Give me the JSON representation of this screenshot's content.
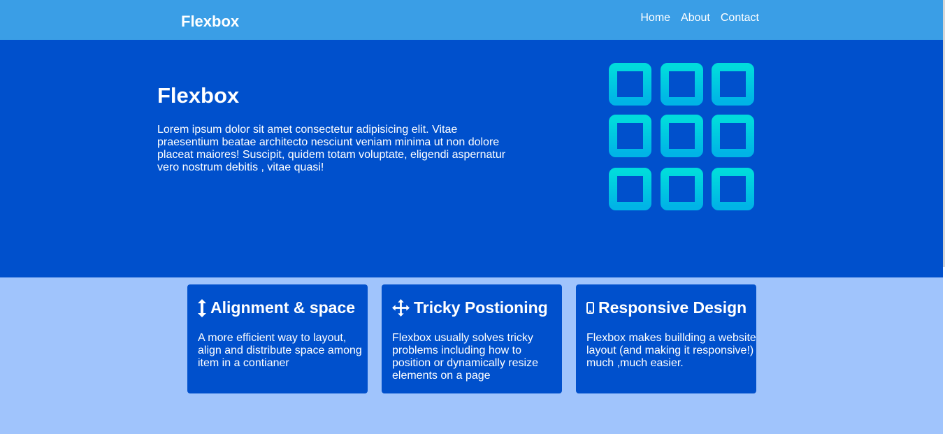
{
  "navbar": {
    "brand": "Flexbox",
    "links": [
      "Home",
      "About",
      "Contact"
    ]
  },
  "hero": {
    "title": "Flexbox",
    "text": "Lorem ipsum dolor sit amet consectetur adipisicing elit. Vitae praesentium beatae architecto nesciunt veniam minima ut non dolore placeat maiores! Suscipit, quidem totam voluptate, eligendi aspernatur vero nostrum debitis , vitae quasi!",
    "graphic_icon": "grid-of-squares-icon"
  },
  "cards": [
    {
      "icon": "vertical-arrows-icon",
      "title": "Alignment & space",
      "text": "A more efficient way to layout, align and distribute space among item in a contianer"
    },
    {
      "icon": "move-arrows-icon",
      "title": "Tricky Postioning",
      "text": "Flexbox usually solves tricky problems including how to position or dynamically resize elements on a page"
    },
    {
      "icon": "mobile-phone-icon",
      "title": "Responsive Design",
      "text": "Flexbox makes buillding a website layout (and making it responsive!) much ,much easier."
    }
  ],
  "colors": {
    "navbar": "#3a9ee6",
    "hero": "#0050cc",
    "page_background": "#a0c4fc",
    "card": "#0050cc",
    "grid_gradient_top": "#00dcdc",
    "grid_gradient_bottom": "#00b4e6"
  }
}
